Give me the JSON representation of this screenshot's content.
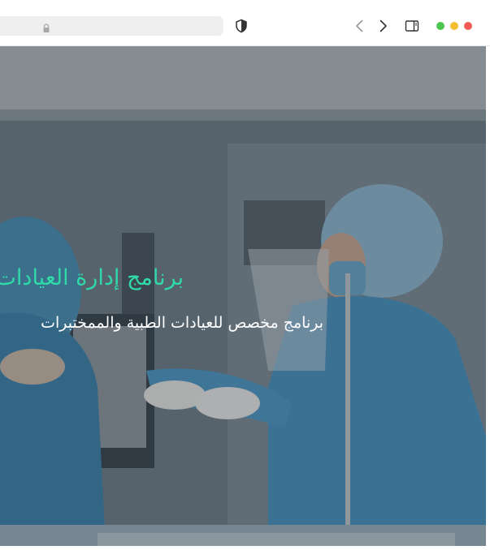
{
  "browser": {
    "address_text": "",
    "colors": {
      "toolbar_bg": "#ffffff",
      "address_bg": "#efefef",
      "close": "#f25c57",
      "minimize": "#f5bf33",
      "zoom": "#4cc650"
    },
    "icons": {
      "lock": "lock-icon",
      "shield": "shield-icon",
      "back": "chevron-left-icon",
      "forward": "chevron-right-icon",
      "sidebar": "sidebar-icon"
    }
  },
  "hero": {
    "title": "برنامج إدارة العيادات",
    "subtitle": "برنامج مخصص للعيادات الطبية والممختبرات",
    "colors": {
      "title": "#2fd9a8",
      "subtitle": "#ffffff"
    }
  }
}
